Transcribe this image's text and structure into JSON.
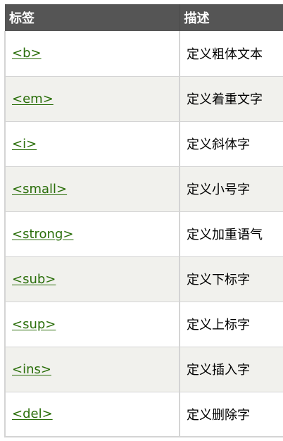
{
  "table": {
    "headers": [
      "标签",
      "描述"
    ],
    "rows": [
      {
        "tag": "<b>",
        "desc": "定义粗体文本"
      },
      {
        "tag": "<em>",
        "desc": "定义着重文字"
      },
      {
        "tag": "<i>",
        "desc": "定义斜体字"
      },
      {
        "tag": "<small>",
        "desc": "定义小号字"
      },
      {
        "tag": "<strong>",
        "desc": "定义加重语气"
      },
      {
        "tag": "<sub>",
        "desc": "定义下标字"
      },
      {
        "tag": "<sup>",
        "desc": "定义上标字"
      },
      {
        "tag": "<ins>",
        "desc": "定义插入字"
      },
      {
        "tag": "<del>",
        "desc": "定义删除字"
      }
    ]
  },
  "colors": {
    "header_bg": "#555555",
    "link": "#2a6e0a",
    "alt_row": "#f1f1ed"
  }
}
